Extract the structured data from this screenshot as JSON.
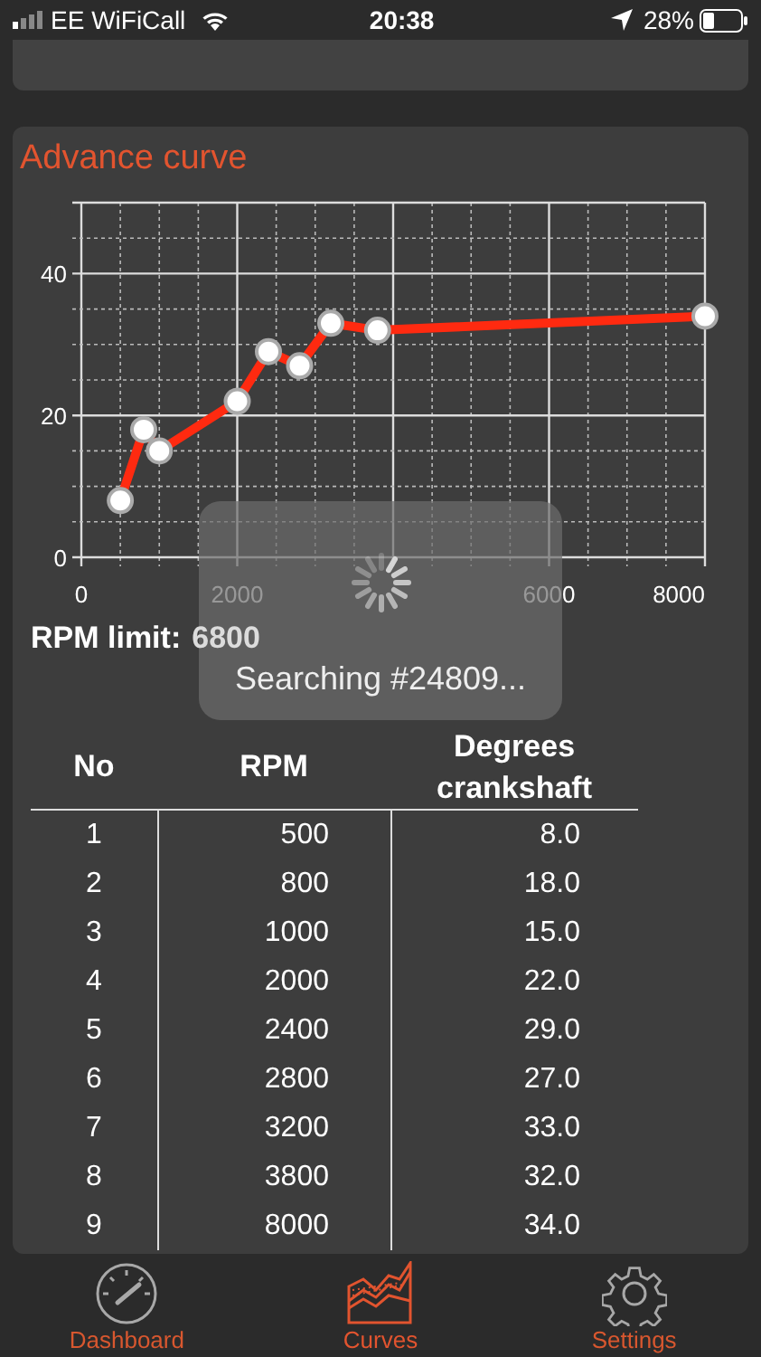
{
  "status_bar": {
    "carrier": "EE WiFiCall",
    "time": "20:38",
    "battery": "28%"
  },
  "card": {
    "title": "Advance curve",
    "chart_data": {
      "type": "line",
      "grid": true,
      "xlim": [
        0,
        8000
      ],
      "ylim": [
        0,
        50
      ],
      "xticks": [
        0,
        2000,
        6000,
        8000
      ],
      "yticks": [
        0,
        20,
        40
      ],
      "x": [
        500,
        800,
        1000,
        2000,
        2400,
        2800,
        3200,
        3800,
        8000
      ],
      "series": [
        {
          "color": "#ff2a10",
          "marker": "circle",
          "values": [
            8,
            18,
            15,
            22,
            29,
            27,
            33,
            32,
            34
          ]
        }
      ]
    },
    "rpm_limit": {
      "label": "RPM limit:",
      "value": "6800"
    },
    "table": {
      "columns": [
        "No",
        "RPM",
        "Degrees crankshaft"
      ],
      "rows": [
        [
          "1",
          "500",
          "8.0"
        ],
        [
          "2",
          "800",
          "18.0"
        ],
        [
          "3",
          "1000",
          "15.0"
        ],
        [
          "4",
          "2000",
          "22.0"
        ],
        [
          "5",
          "2400",
          "29.0"
        ],
        [
          "6",
          "2800",
          "27.0"
        ],
        [
          "7",
          "3200",
          "33.0"
        ],
        [
          "8",
          "3800",
          "32.0"
        ],
        [
          "9",
          "8000",
          "34.0"
        ]
      ]
    }
  },
  "overlay": {
    "message": "Searching #24809..."
  },
  "tabs": [
    {
      "kind": "gauge",
      "label": "Dashboard",
      "selected": false
    },
    {
      "kind": "curves",
      "label": "Curves",
      "selected": true
    },
    {
      "kind": "gear",
      "label": "Settings",
      "selected": false
    }
  ]
}
